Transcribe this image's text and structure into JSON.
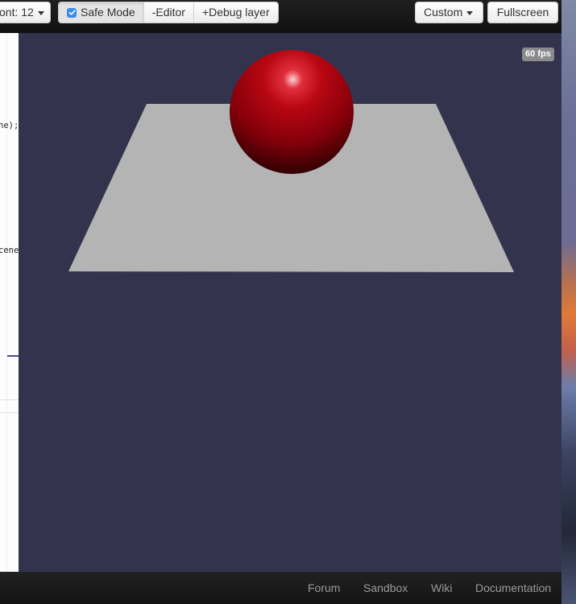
{
  "toolbar": {
    "font_label": "ont: 12",
    "safe_mode_label": "Safe Mode",
    "safe_mode_checked": true,
    "editor_toggle_label": "-Editor",
    "debug_layer_label": "+Debug layer",
    "custom_label": "Custom",
    "fullscreen_label": "Fullscreen"
  },
  "editor": {
    "visible_fragments": [
      "ne);",
      "cene"
    ]
  },
  "scene": {
    "fps_label": "60 fps",
    "background_color": "#33334d",
    "ground_color": "#b4b4b4",
    "sphere_color": "#b0000f",
    "objects": [
      "sphere",
      "ground"
    ]
  },
  "footer": {
    "links": [
      "Forum",
      "Sandbox",
      "Wiki",
      "Documentation"
    ]
  }
}
